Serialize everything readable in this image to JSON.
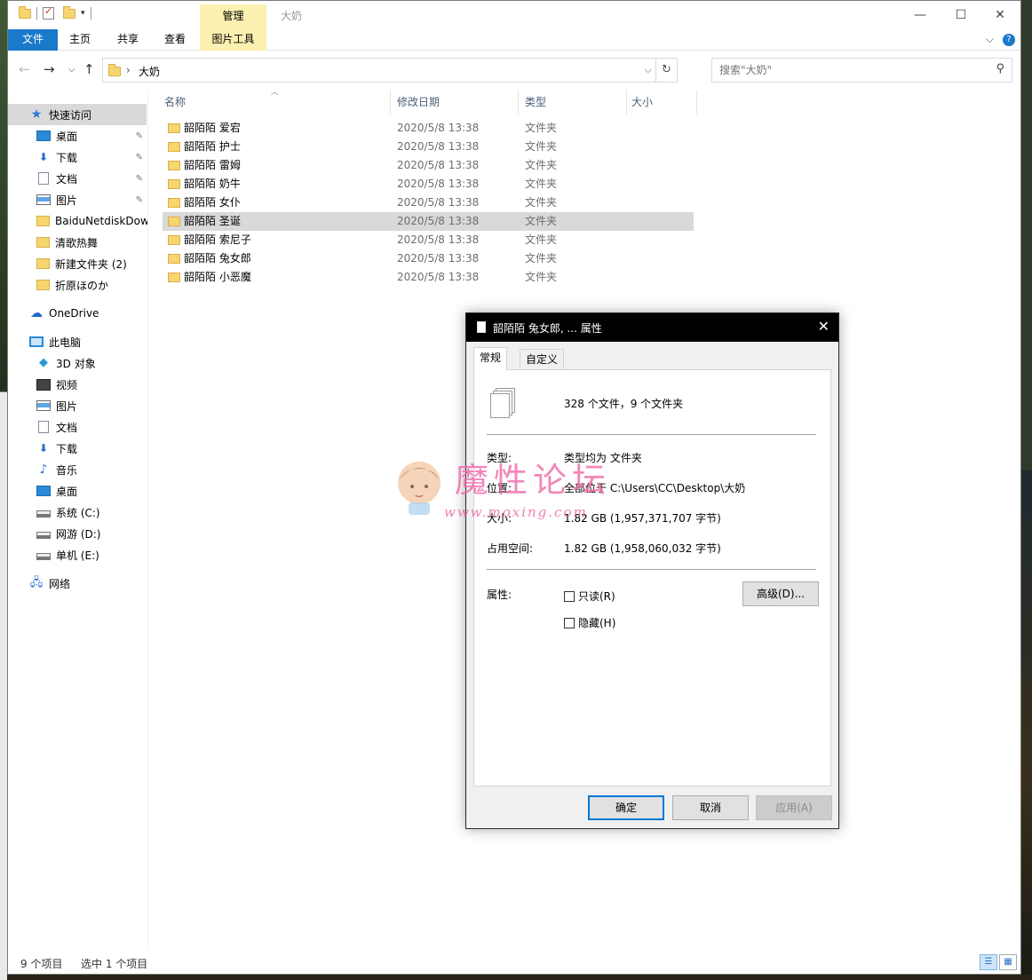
{
  "title_bar": {
    "manage_tab": "管理",
    "window_title": "大奶",
    "minimize": "—",
    "maximize": "☐",
    "close": "✕"
  },
  "ribbon": {
    "tabs": [
      "文件",
      "主页",
      "共享",
      "查看",
      "图片工具"
    ],
    "collapse": "⌵",
    "help": "?"
  },
  "address": {
    "back": "←",
    "forward": "→",
    "recent": "⌵",
    "up": "↑",
    "crumb_sep": "›",
    "path": "大奶",
    "dropdown": "⌵",
    "refresh": "↻"
  },
  "search": {
    "placeholder": "搜索\"大奶\"",
    "icon": "search-icon"
  },
  "sidebar": {
    "items": [
      {
        "label": "快速访问",
        "icon": "star-icon"
      },
      {
        "label": "桌面",
        "icon": "desktop-icon",
        "pinned": true
      },
      {
        "label": "下载",
        "icon": "download-icon",
        "pinned": true
      },
      {
        "label": "文档",
        "icon": "document-icon",
        "pinned": true
      },
      {
        "label": "图片",
        "icon": "pictures-icon",
        "pinned": true
      },
      {
        "label": "BaiduNetdiskDow",
        "icon": "folder-icon"
      },
      {
        "label": "清歌热舞",
        "icon": "folder-icon"
      },
      {
        "label": "新建文件夹 (2)",
        "icon": "folder-icon"
      },
      {
        "label": "折原ほのか",
        "icon": "folder-icon"
      },
      {
        "label": "OneDrive",
        "icon": "cloud-icon"
      },
      {
        "label": "此电脑",
        "icon": "computer-icon"
      },
      {
        "label": "3D 对象",
        "icon": "cube-icon"
      },
      {
        "label": "视频",
        "icon": "video-icon"
      },
      {
        "label": "图片",
        "icon": "pictures-icon"
      },
      {
        "label": "文档",
        "icon": "document-icon"
      },
      {
        "label": "下载",
        "icon": "download-icon"
      },
      {
        "label": "音乐",
        "icon": "music-icon"
      },
      {
        "label": "桌面",
        "icon": "desktop-icon"
      },
      {
        "label": "系统 (C:)",
        "icon": "drive-icon"
      },
      {
        "label": "网游 (D:)",
        "icon": "drive-icon"
      },
      {
        "label": "单机 (E:)",
        "icon": "drive-icon"
      },
      {
        "label": "网络",
        "icon": "network-icon"
      }
    ],
    "pin_glyph": "📌"
  },
  "file_list": {
    "columns": {
      "name": "名称",
      "date": "修改日期",
      "type": "类型",
      "size": "大小"
    },
    "rows": [
      {
        "name": "韶陌陌 爱宕",
        "date": "2020/5/8 13:38",
        "type": "文件夹"
      },
      {
        "name": "韶陌陌 护士",
        "date": "2020/5/8 13:38",
        "type": "文件夹"
      },
      {
        "name": "韶陌陌 雷姆",
        "date": "2020/5/8 13:38",
        "type": "文件夹"
      },
      {
        "name": "韶陌陌 奶牛",
        "date": "2020/5/8 13:38",
        "type": "文件夹"
      },
      {
        "name": "韶陌陌 女仆",
        "date": "2020/5/8 13:38",
        "type": "文件夹"
      },
      {
        "name": "韶陌陌 圣诞",
        "date": "2020/5/8 13:38",
        "type": "文件夹",
        "selected": true
      },
      {
        "name": "韶陌陌 索尼子",
        "date": "2020/5/8 13:38",
        "type": "文件夹"
      },
      {
        "name": "韶陌陌 兔女郎",
        "date": "2020/5/8 13:38",
        "type": "文件夹"
      },
      {
        "name": "韶陌陌 小恶魔",
        "date": "2020/5/8 13:38",
        "type": "文件夹"
      }
    ]
  },
  "status": {
    "items": "9 个项目",
    "selected": "选中 1 个项目"
  },
  "dialog": {
    "title": "韶陌陌 兔女郎, ... 属性",
    "close": "✕",
    "tabs": {
      "general": "常规",
      "custom": "自定义"
    },
    "count": "328 个文件，9 个文件夹",
    "type_label": "类型:",
    "type_value": "类型均为 文件夹",
    "location_label": "位置:",
    "location_value": "全部位于 C:\\Users\\CC\\Desktop\\大奶",
    "size_label": "大小:",
    "size_value": "1.82 GB (1,957,371,707 字节)",
    "disk_label": "占用空间:",
    "disk_value": "1.82 GB (1,958,060,032 字节)",
    "attr_label": "属性:",
    "readonly": "只读(R)",
    "hidden": "隐藏(H)",
    "advanced": "高级(D)...",
    "ok": "确定",
    "cancel": "取消",
    "apply": "应用(A)"
  },
  "watermark": {
    "title": "魔性论坛",
    "url": "www.moxing.com"
  }
}
